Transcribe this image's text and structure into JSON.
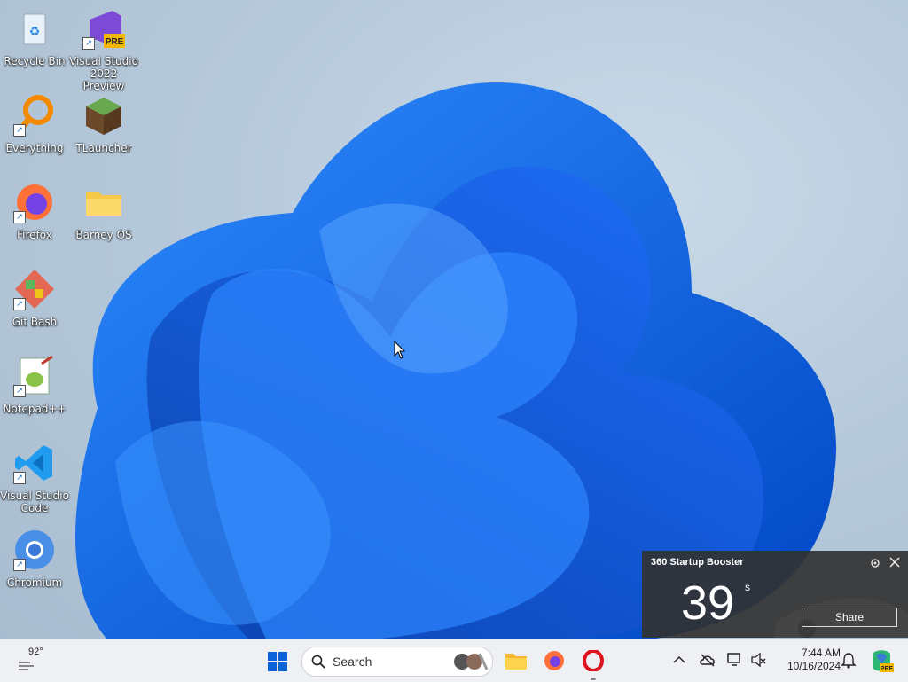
{
  "desktop": {
    "icons": [
      {
        "label": "Recycle Bin"
      },
      {
        "label": "Visual Studio 2022 Preview",
        "badge": "PRE"
      },
      {
        "label": "Everything"
      },
      {
        "label": "TLauncher"
      },
      {
        "label": "Firefox"
      },
      {
        "label": "Barney OS"
      },
      {
        "label": "Git Bash"
      },
      {
        "label": "Notepad++"
      },
      {
        "label": "Visual Studio Code"
      },
      {
        "label": "Chromium"
      }
    ]
  },
  "booster": {
    "title": "360 Startup Booster",
    "seconds": "39",
    "unit": "s",
    "share_label": "Share"
  },
  "taskbar": {
    "weather_temp": "92°",
    "search_placeholder": "Search",
    "time": "7:44 AM",
    "date": "10/16/2024",
    "copilot_badge": "PRE"
  },
  "colors": {
    "accent": "#0a64d8",
    "taskbar_bg": "#eef0f3",
    "booster_bg": "#323232"
  }
}
